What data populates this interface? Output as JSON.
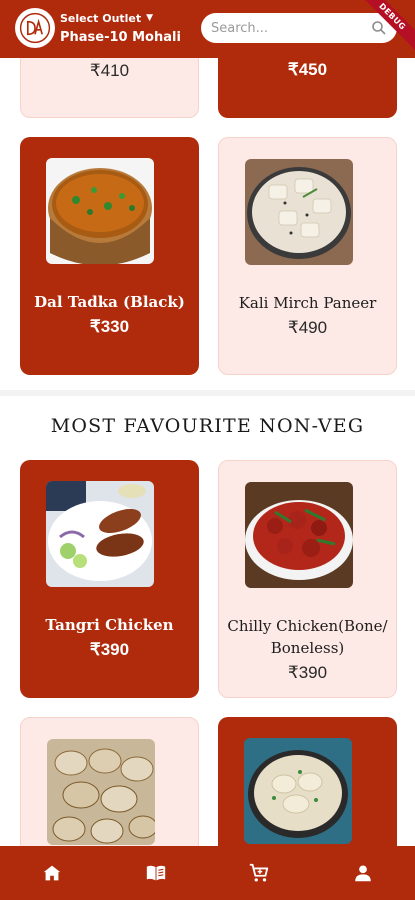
{
  "header": {
    "outlet_label": "Select Outlet",
    "outlet_name": "Phase-10 Mohali",
    "search_placeholder": "Search...",
    "debug_banner": "DEBUG",
    "brand_color": "#b02a0c"
  },
  "menu": {
    "top_row": [
      {
        "name": "",
        "price": "₹410",
        "style": "light"
      },
      {
        "name": "",
        "price": "₹450",
        "style": "red"
      }
    ],
    "veg_items": [
      {
        "name": "Dal Tadka (Black)",
        "price": "₹330",
        "style": "red",
        "image": "dal-tadka-image"
      },
      {
        "name": "Kali Mirch Paneer",
        "price": "₹490",
        "style": "light",
        "image": "kali-mirch-paneer-image"
      }
    ],
    "section_title": "MOST FAVOURITE NON-VEG",
    "nonveg_items": [
      {
        "name": "Tangri Chicken",
        "price": "₹390",
        "style": "red",
        "image": "tangri-chicken-image"
      },
      {
        "name": "Chilly Chicken(Bone/ Boneless)",
        "price": "₹390",
        "style": "light",
        "image": "chilly-chicken-image"
      },
      {
        "name": "",
        "price": "",
        "style": "light",
        "image": "tandoori-chicken-image"
      },
      {
        "name": "",
        "price": "",
        "style": "red",
        "image": "chicken-curry-image"
      }
    ]
  },
  "bottom_nav": [
    {
      "icon": "home-icon"
    },
    {
      "icon": "menu-book-icon"
    },
    {
      "icon": "cart-icon"
    },
    {
      "icon": "profile-icon"
    }
  ]
}
